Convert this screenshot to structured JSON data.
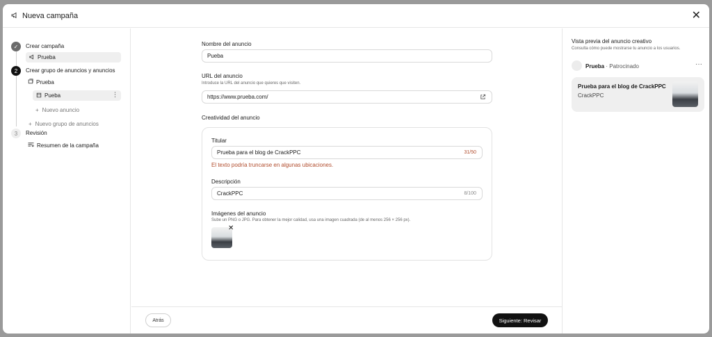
{
  "header": {
    "title": "Nueva campaña"
  },
  "stepper": {
    "step1": {
      "label": "Crear campaña",
      "child": "Prueba"
    },
    "step2": {
      "number": "2",
      "label": "Crear grupo de anuncios y anuncios",
      "group": "Prueba",
      "ad": "Pueba",
      "new_ad": "Nuevo anuncio",
      "new_group": "Nuevo grupo de anuncios"
    },
    "step3": {
      "number": "3",
      "label": "Revisión",
      "child": "Resumen de la campaña"
    }
  },
  "form": {
    "ad_name": {
      "label": "Nombre del anuncio",
      "value": "Pueba"
    },
    "ad_url": {
      "label": "URL del anuncio",
      "help": "Introduce la URL del anuncio que quieres que visiten.",
      "value": "https://www.prueba.com/"
    },
    "creative": {
      "title": "Creatividad del anuncio",
      "headline": {
        "label": "Titular",
        "value": "Prueba para el blog de CrackPPC",
        "counter": "31/50",
        "warning": "El texto podría truncarse en algunas ubicaciones."
      },
      "description": {
        "label": "Descripción",
        "value": "CrackPPC",
        "counter": "8/100"
      },
      "images": {
        "label": "Imágenes del anuncio",
        "help": "Sube un PNG o JPG. Para obtener la mejor calidad, usa una imagen cuadrada (de al menos 256 × 256 px)."
      }
    }
  },
  "footer": {
    "back_label": "Atrás",
    "next_label": "Siguiente: Revisar"
  },
  "preview": {
    "title": "Vista previa del anuncio creativo",
    "subtitle": "Consulta cómo puede mostrarse tu anuncio a los usuarios.",
    "account": "Prueba",
    "sponsored": "· Patrocinado",
    "headline": "Prueba para el blog de CrackPPC",
    "description": "CrackPPC"
  }
}
